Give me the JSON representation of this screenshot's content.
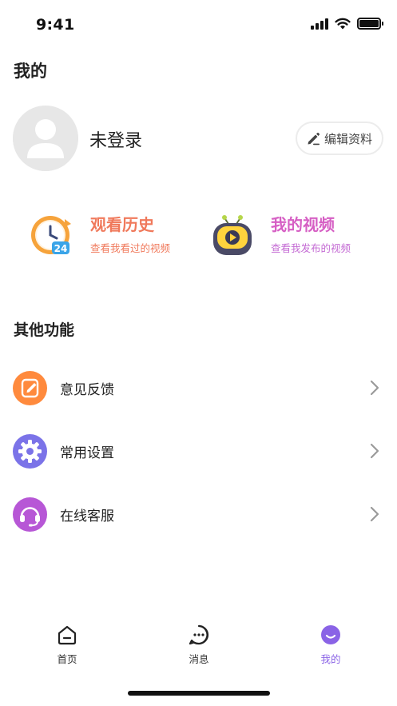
{
  "status_bar": {
    "time": "9:41",
    "battery_level_percent": 100
  },
  "page_title": "我的",
  "profile": {
    "username": "未登录",
    "edit_label": "编辑资料"
  },
  "features": [
    {
      "title": "观看历史",
      "subtitle": "查看我看过的视频",
      "icon": "history-clock-icon",
      "color": "#f0795b"
    },
    {
      "title": "我的视频",
      "subtitle": "查看我发布的视频",
      "icon": "tv-play-icon",
      "color": "#d65fc4"
    }
  ],
  "section_title": "其他功能",
  "menu": [
    {
      "label": "意见反馈",
      "icon": "feedback-edit-icon",
      "color": "#ff8a3d"
    },
    {
      "label": "常用设置",
      "icon": "settings-gear-icon",
      "color": "#7b73e8"
    },
    {
      "label": "在线客服",
      "icon": "headset-icon",
      "color": "#b757d6"
    }
  ],
  "tabs": [
    {
      "label": "首页",
      "icon": "home-icon"
    },
    {
      "label": "消息",
      "icon": "message-icon"
    },
    {
      "label": "我的",
      "icon": "profile-smile-icon",
      "active": true
    }
  ],
  "colors": {
    "accent": "#8a63e6",
    "text": "#222222",
    "muted": "#999999"
  }
}
